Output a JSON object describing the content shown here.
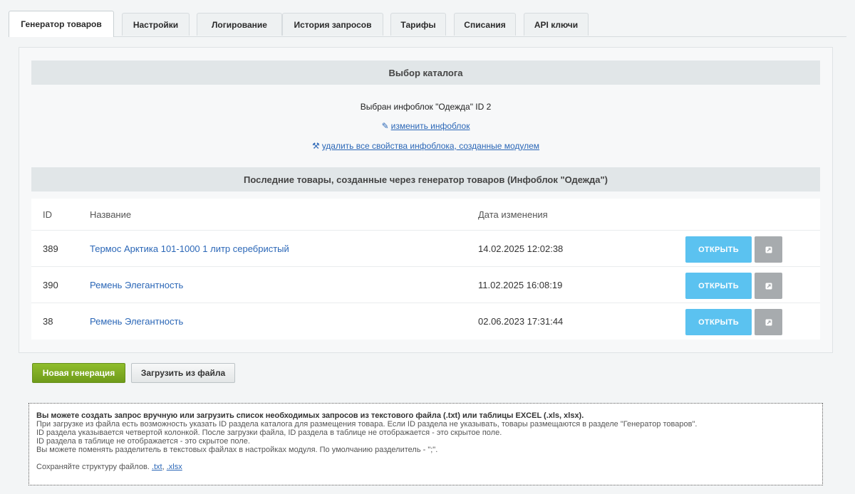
{
  "tabs": [
    {
      "label": "Генератор товаров",
      "active": true
    },
    {
      "label": "Настройки"
    },
    {
      "label": "Логирование"
    },
    {
      "label": "История запросов"
    },
    {
      "label": "Тарифы"
    },
    {
      "label": "Списания"
    },
    {
      "label": "API ключи"
    }
  ],
  "catalog": {
    "header": "Выбор каталога",
    "selected": "Выбран инфоблок \"Одежда\" ID 2",
    "change_link": "изменить инфоблок",
    "delete_link": "удалить все свойства инфоблока, созданные модулем"
  },
  "recent": {
    "header": "Последние товары, созданные через генератор товаров (Инфоблок \"Одежда\")",
    "columns": {
      "id": "ID",
      "name": "Название",
      "date": "Дата изменения"
    },
    "rows": [
      {
        "id": "389",
        "name": "Термос Арктика 101-1000 1 литр серебристый",
        "date": "14.02.2025 12:02:38",
        "open": "ОТКРЫТЬ"
      },
      {
        "id": "390",
        "name": "Ремень Элегантность",
        "date": "11.02.2025 16:08:19",
        "open": "ОТКРЫТЬ"
      },
      {
        "id": "38",
        "name": "Ремень Элегантность",
        "date": "02.06.2023 17:31:44",
        "open": "ОТКРЫТЬ"
      }
    ]
  },
  "actions": {
    "new_generation": "Новая генерация",
    "upload_file": "Загрузить из файла"
  },
  "info": {
    "bold_line": "Вы можете создать запрос вручную или загрузить список необходимых запросов из текстового файла (.txt) или таблицы EXCEL (.xls, xlsx).",
    "lines": [
      "При загрузке из файла есть возможность указать ID раздела каталога для размещения товара. Если ID раздела не указывать, товары размещаются в разделе \"Генератор товаров\".",
      "ID раздела указывается четвертой колонкой. После загрузки файла, ID раздела в таблице не отображается - это скрытое поле.",
      "ID раздела в таблице не отображается - это скрытое поле.",
      "Вы можете поменять разделитель в текстовых файлах в настройках модуля. По умолчанию разделитель - \";\"."
    ],
    "save_text": "Сохраняйте структуру файлов.",
    "link_txt": ".txt",
    "separator": ",",
    "link_xlsx": ".xlsx"
  },
  "colors": {
    "accent_blue": "#5bc2f0",
    "link": "#2b67b7",
    "green_button": "#7aa823"
  }
}
